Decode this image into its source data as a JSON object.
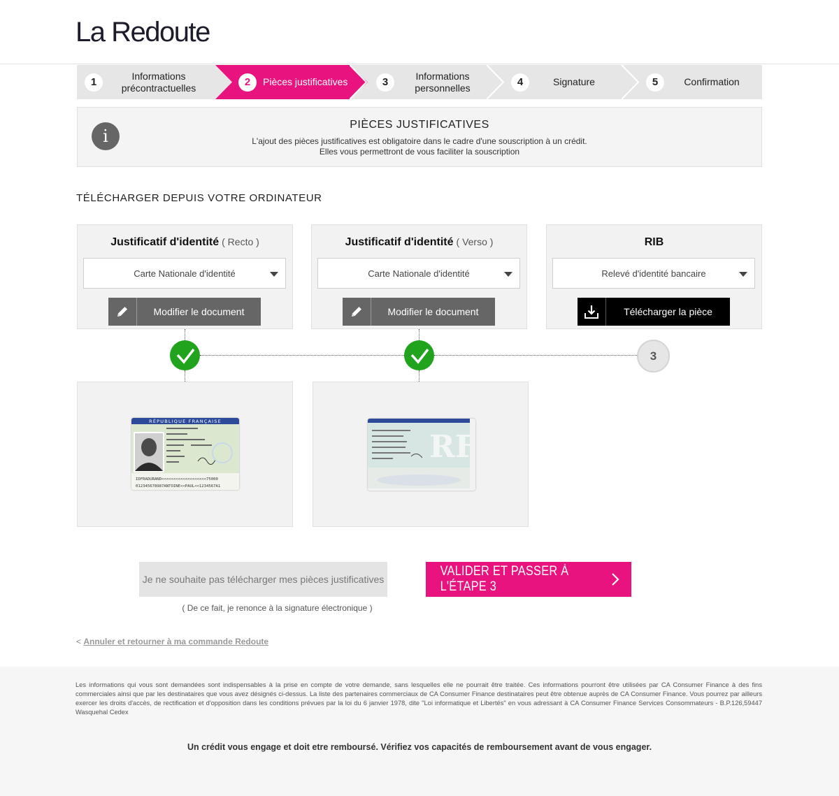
{
  "brand": {
    "logo_text": "La Redoute",
    "accent_color": "#e8137e"
  },
  "stepper": {
    "steps": [
      {
        "number": "1",
        "label": "Informations précontractuelles",
        "active": false
      },
      {
        "number": "2",
        "label": "Pièces justificatives",
        "active": true
      },
      {
        "number": "3",
        "label": "Informations personnelles",
        "active": false
      },
      {
        "number": "4",
        "label": "Signature",
        "active": false
      },
      {
        "number": "5",
        "label": "Confirmation",
        "active": false
      }
    ]
  },
  "info": {
    "icon": "info-icon",
    "icon_glyph": "i",
    "title": "PIÈCES JUSTIFICATIVES",
    "line1": "L'ajout des pièces justificatives est obligatoire dans le cadre d'une souscription à un crédit.",
    "line2": "Elles vous permettront de vous faciliter la souscription"
  },
  "section_title": "TÉLÉCHARGER DEPUIS VOTRE ORDINATEUR",
  "cards": [
    {
      "title": "Justificatif d'identité",
      "subtitle": "( Recto )",
      "select_value": "Carte Nationale d'identité",
      "button_label": "Modifier le document",
      "button_icon": "pencil-icon",
      "status": "done"
    },
    {
      "title": "Justificatif d'identité",
      "subtitle": "( Verso )",
      "select_value": "Carte Nationale d'identité",
      "button_label": "Modifier le document",
      "button_icon": "pencil-icon",
      "status": "done"
    },
    {
      "title": "RIB",
      "subtitle": "",
      "select_value": "Relevé d'identité bancaire",
      "button_label": "Télécharger la pièce",
      "button_icon": "download-icon",
      "status": "pending",
      "status_number": "3"
    }
  ],
  "id_front": {
    "header": "RÉPUBLIQUE FRANÇAISE",
    "mrz1": "IDFRADURAND<<<<<<<<<<<<<<<<<<<75000",
    "mrz2": "012345678987ANTOINE<<PAUL<<1234567A1"
  },
  "actions": {
    "decline_label": "Je ne souhaite pas télécharger mes pièces justificatives",
    "decline_note": "( De ce fait, je renonce à la signature électronique )",
    "validate_label": "VALIDER ET PASSER À L'ÉTAPE 3",
    "cancel_prefix": "<",
    "cancel_link": "Annuler et retourner à ma commande Redoute"
  },
  "footer": {
    "legal": "Les informations qui vous sont demandées sont indispensables à la prise en compte de votre demande, sans lesquelles elle ne pourrait être traitée. Ces informations pourront être utilisées par CA Consumer Finance à des fins commerciales ainsi que par les destinataires que vous avez désignés ci-dessus. La liste des partenaires commerciaux de CA Consumer Finance destinataires peut être obtenue auprès de CA Consumer Finance. Vous pourrez par ailleurs exercer les droits d'accès, de rectification et d'opposition dans les conditions prévues par la loi du 6 janvier 1978, dite \"Loi informatique et Libertés\" en vous adressant à CA Consumer Finance Services Consommateurs - B.P.126,59447 Wasquehal Cedex",
    "warning": "Un crédit vous engage et doit etre remboursé. Vérifiez vos capacités de remboursement avant de vous engager."
  }
}
